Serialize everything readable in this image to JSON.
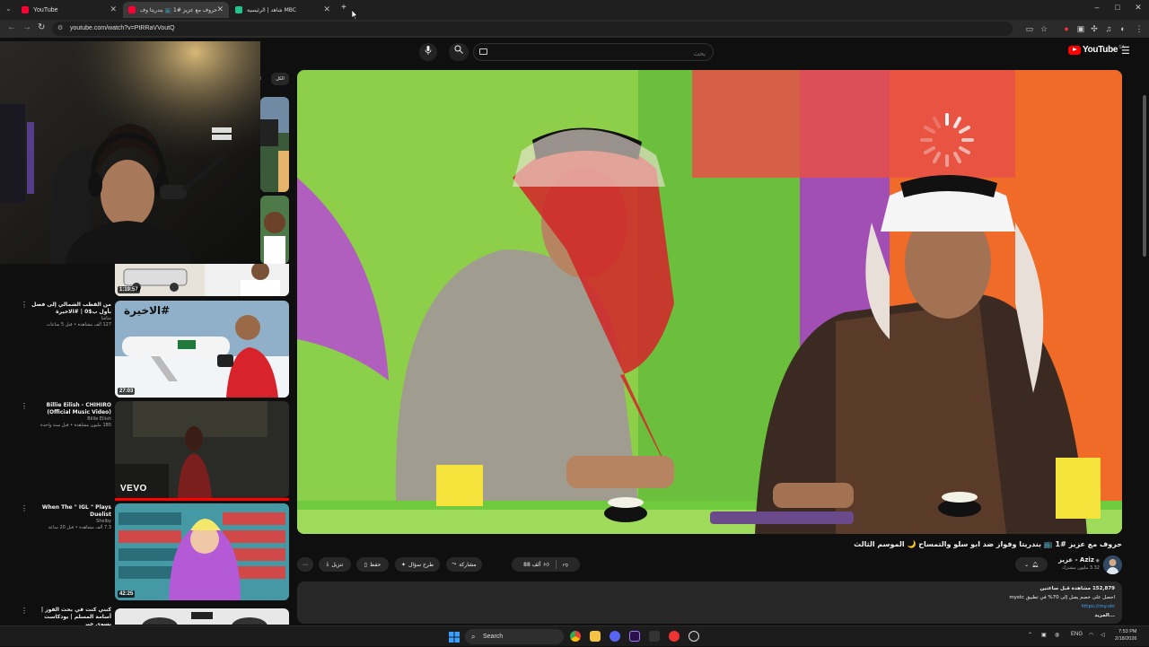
{
  "browser": {
    "tabs": [
      {
        "title": "YouTube",
        "favicon_color": "#ff0033"
      },
      {
        "title": "حروف مع عزيز #1 📺 بندريتا وف…",
        "favicon_color": "#ff0033"
      },
      {
        "title": "شاهد | الرئيسية MBC",
        "favicon_color": "#1fc58c"
      }
    ],
    "new_tab_icon": "+",
    "url": "youtube.com/watch?v=PtRRaVVoutQ",
    "window_controls": [
      "–",
      "□",
      "✕"
    ]
  },
  "header": {
    "logo_text": "YouTube",
    "logo_region": "SA",
    "search_placeholder": "بحث",
    "mic_icon": "microphone-icon",
    "search_icon": "search-icon",
    "menu_icon": "hamburger-menu-icon"
  },
  "sidebar": {
    "chip": "الكل",
    "items": [
      {
        "duration": "1:19:57",
        "title": "",
        "channel": "",
        "stats": ""
      },
      {
        "duration": "27:03",
        "title": "من القطب الشمالي إلى فصل بأول ب$0 | #الاخيرة",
        "channel": "شاشا",
        "stats": "127 ألف مشاهدة • قبل 5 ساعات",
        "thumb_text": "#الاخيرة"
      },
      {
        "duration": "",
        "title": "Billie Eilish - CHIHIRO (Official Music Video)",
        "channel": "Billie Eilish",
        "stats": "185 مليون مشاهدة • قبل سنة واحدة",
        "thumb_text": "vevo"
      },
      {
        "duration": "42:25",
        "title": "When The \" IGL \" Plays Duelist",
        "channel": "Shelby",
        "stats": "7.3 ألف مشاهدة • قبل 20 ساعة"
      },
      {
        "duration": "",
        "title": "كنني كنت في بحث الفوز | أسامة المسلم | بودكاست بسوي خير",
        "channel": "",
        "stats": ""
      }
    ]
  },
  "video": {
    "title": "حروف مع عزيز #1 📺 بندريتا وفواز ضد ابو سلو والتمساح 🌙 الموسم الثالث",
    "channel_name": "Aziz - عزيز",
    "channel_subs": "3.32 مليون مشترك",
    "likes": "ألف 88",
    "actions": {
      "share": "مشاركة",
      "ask": "طرح سؤال",
      "save": "حفظ",
      "download": "تنزيل",
      "more": "⋯"
    },
    "description": {
      "stats": "152,879 مشاهدة قبل ساعتين",
      "line1": "احصل على خصم يصل إلى 70% في تطبيق mystc",
      "link": "https://my.stc",
      "more": "...المزيد"
    }
  },
  "taskbar": {
    "search_label": "Search",
    "lang": "ENG",
    "time": "7:53 PM",
    "date": "2/18/2026"
  }
}
